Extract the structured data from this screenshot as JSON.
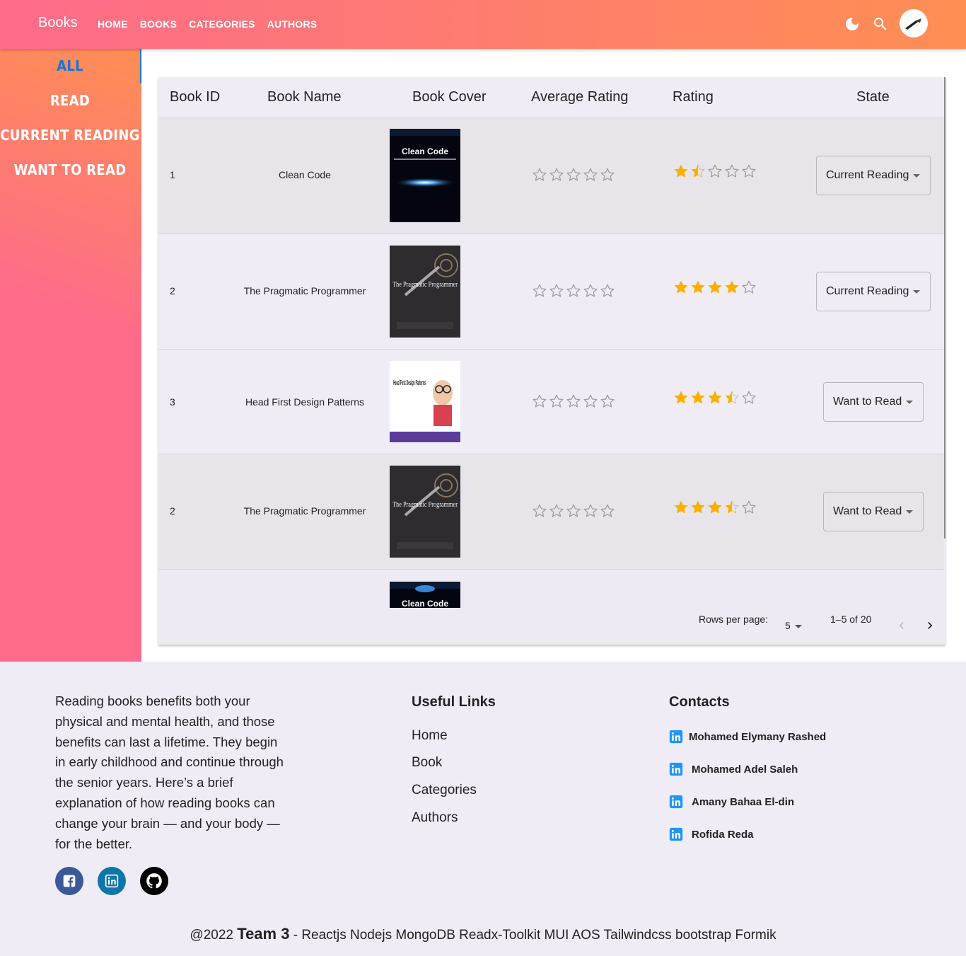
{
  "header": {
    "brand": "Books",
    "nav": [
      "HOME",
      "BOOKS",
      "CATEGORIES",
      "AUTHORS"
    ],
    "icons": [
      "dark-mode-icon",
      "search-icon",
      "avatar"
    ]
  },
  "sidebar": {
    "items": [
      "ALL",
      "READ",
      "CURRENT READING",
      "WANT TO READ"
    ],
    "active": "ALL"
  },
  "table": {
    "columns": [
      "Book ID",
      "Book Name",
      "Book Cover",
      "Average Rating",
      "Rating",
      "State"
    ],
    "rows": [
      {
        "id": "1",
        "name": "Clean Code",
        "cover": "Clean Code",
        "avg_rating": 0,
        "rating": 1.5,
        "state": "Current Reading"
      },
      {
        "id": "2",
        "name": "The Pragmatic Programmer",
        "cover": "The Pragmatic Programmer",
        "avg_rating": 0,
        "rating": 4,
        "state": "Current Reading"
      },
      {
        "id": "3",
        "name": "Head First Design Patterns",
        "cover": "Head First Design Patterns",
        "avg_rating": 0,
        "rating": 3.5,
        "state": "Want to Read"
      },
      {
        "id": "2",
        "name": "The Pragmatic Programmer",
        "cover": "The Pragmatic Programmer",
        "avg_rating": 0,
        "rating": 3.5,
        "state": "Want to Read"
      }
    ],
    "partial_cover": "Clean Code",
    "pagination": {
      "rows_per_page_label": "Rows per page:",
      "rows_per_page": "5",
      "range": "1–5 of 20"
    }
  },
  "colors": {
    "gradient_start": "#fe6b8b",
    "gradient_end": "#ff8e53",
    "active": "#1976d2",
    "star": "#faaf00"
  },
  "footer": {
    "about": "Reading books benefits both your physical and mental health, and those benefits can last a lifetime. They begin in early childhood and continue through the senior years. Here’s a brief explanation of how reading books can change your brain — and your body — for the better.",
    "social": [
      "facebook-icon",
      "linkedin-icon",
      "github-icon"
    ],
    "links_title": "Useful Links",
    "links": [
      "Home",
      "Book",
      "Categories",
      "Authors"
    ],
    "contacts_title": "Contacts",
    "contacts": [
      "Mohamed Elymany Rashed",
      "Mohamed Adel Saleh",
      "Amany Bahaa El-din",
      "Rofida Reda"
    ],
    "credit_prefix": "@2022",
    "credit_team": "Team 3",
    "credit_suffix": "- Reactjs Nodejs MongoDB Readx-Toolkit MUI AOS Tailwindcss bootstrap Formik"
  }
}
